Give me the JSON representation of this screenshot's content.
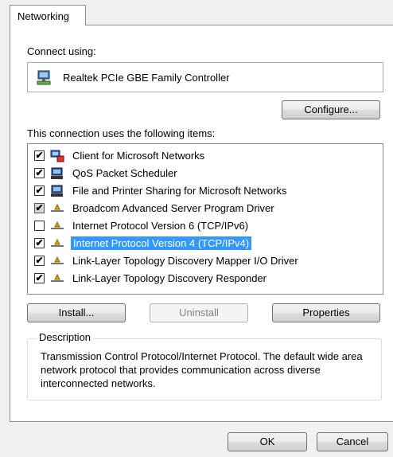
{
  "tab": {
    "label": "Networking"
  },
  "connect_using": {
    "label": "Connect using:",
    "adapter": "Realtek PCIe GBE Family Controller",
    "adapter_icon": "network-adapter-icon"
  },
  "buttons": {
    "configure": "Configure...",
    "install": "Install...",
    "uninstall": "Uninstall",
    "properties": "Properties",
    "ok": "OK",
    "cancel": "Cancel"
  },
  "items_label": "This connection uses the following items:",
  "items": [
    {
      "label": "Client for Microsoft Networks",
      "checked": true,
      "icon": "client-network-icon"
    },
    {
      "label": "QoS Packet Scheduler",
      "checked": true,
      "icon": "service-icon"
    },
    {
      "label": "File and Printer Sharing for Microsoft Networks",
      "checked": true,
      "icon": "service-icon"
    },
    {
      "label": "Broadcom Advanced Server Program Driver",
      "checked": true,
      "grayed": true,
      "icon": "protocol-icon"
    },
    {
      "label": "Internet Protocol Version 6 (TCP/IPv6)",
      "checked": false,
      "icon": "protocol-icon"
    },
    {
      "label": "Internet Protocol Version 4 (TCP/IPv4)",
      "checked": true,
      "selected": true,
      "icon": "protocol-icon"
    },
    {
      "label": "Link-Layer Topology Discovery Mapper I/O Driver",
      "checked": true,
      "icon": "protocol-icon"
    },
    {
      "label": "Link-Layer Topology Discovery Responder",
      "checked": true,
      "icon": "protocol-icon"
    }
  ],
  "description": {
    "title": "Description",
    "text": "Transmission Control Protocol/Internet Protocol. The default wide area network protocol that provides communication across diverse interconnected networks."
  },
  "colors": {
    "selection": "#3399ff",
    "panel": "#ffffff",
    "window": "#f0f0f0"
  }
}
